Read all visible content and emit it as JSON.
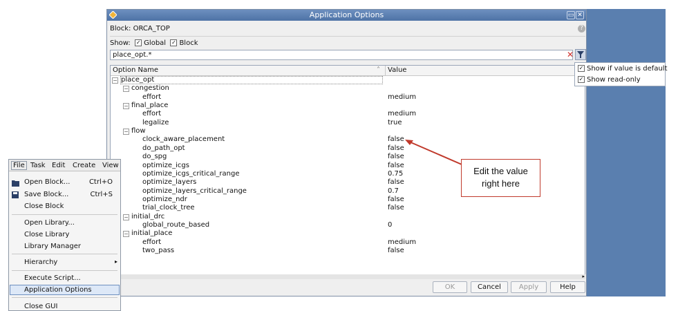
{
  "dialog": {
    "title": "Application Options",
    "block_label": "Block: ORCA_TOP",
    "show_label": "Show:",
    "show_global": "Global",
    "show_block": "Block",
    "filter_text": "place_opt.*",
    "col_option": "Option Name",
    "col_value": "Value",
    "tree": [
      {
        "level": 0,
        "label": "place_opt",
        "value": "",
        "expand": "-"
      },
      {
        "level": 1,
        "label": "congestion",
        "value": "",
        "expand": "-"
      },
      {
        "level": 2,
        "label": "effort",
        "value": "medium"
      },
      {
        "level": 1,
        "label": "final_place",
        "value": "",
        "expand": "-"
      },
      {
        "level": 2,
        "label": "effort",
        "value": "medium"
      },
      {
        "level": 2,
        "label": "legalize",
        "value": "true"
      },
      {
        "level": 1,
        "label": "flow",
        "value": "",
        "expand": "-"
      },
      {
        "level": 2,
        "label": "clock_aware_placement",
        "value": "false"
      },
      {
        "level": 2,
        "label": "do_path_opt",
        "value": "false"
      },
      {
        "level": 2,
        "label": "do_spg",
        "value": "false"
      },
      {
        "level": 2,
        "label": "optimize_icgs",
        "value": "false"
      },
      {
        "level": 2,
        "label": "optimize_icgs_critical_range",
        "value": "0.75"
      },
      {
        "level": 2,
        "label": "optimize_layers",
        "value": "false"
      },
      {
        "level": 2,
        "label": "optimize_layers_critical_range",
        "value": "0.7"
      },
      {
        "level": 2,
        "label": "optimize_ndr",
        "value": "false"
      },
      {
        "level": 2,
        "label": "trial_clock_tree",
        "value": "false"
      },
      {
        "level": 1,
        "label": "initial_drc",
        "value": "",
        "expand": "-"
      },
      {
        "level": 2,
        "label": "global_route_based",
        "value": "0"
      },
      {
        "level": 1,
        "label": "initial_place",
        "value": "",
        "expand": "-"
      },
      {
        "level": 2,
        "label": "effort",
        "value": "medium"
      },
      {
        "level": 2,
        "label": "two_pass",
        "value": "false"
      }
    ],
    "buttons": {
      "ok": "OK",
      "cancel": "Cancel",
      "apply": "Apply",
      "help": "Help"
    }
  },
  "filter_menu": {
    "show_default": "Show if value is default",
    "show_readonly": "Show read-only"
  },
  "menubar": {
    "file": "File",
    "task": "Task",
    "edit": "Edit",
    "create": "Create",
    "view": "View"
  },
  "file_menu": {
    "open_block": "Open Block...",
    "open_block_sc": "Ctrl+O",
    "save_block": "Save Block...",
    "save_block_sc": "Ctrl+S",
    "close_block": "Close Block",
    "open_library": "Open Library...",
    "close_library": "Close Library",
    "library_manager": "Library Manager",
    "hierarchy": "Hierarchy",
    "execute_script": "Execute Script...",
    "application_options": "Application Options",
    "close_gui": "Close GUI"
  },
  "callout": {
    "line1": "Edit the value",
    "line2": "right here"
  },
  "colors": {
    "title_bar": "#4e73a6",
    "background_panel": "#5a7faf",
    "callout_border": "#c0392b",
    "menu_highlight": "#dde8f7"
  }
}
